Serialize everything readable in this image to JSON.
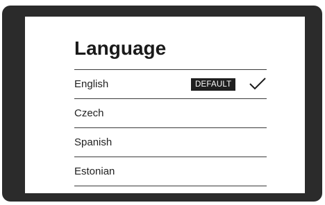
{
  "screen": {
    "title": "Language"
  },
  "languages": [
    {
      "label": "English",
      "badge": "DEFAULT",
      "selected": true
    },
    {
      "label": "Czech",
      "selected": false
    },
    {
      "label": "Spanish",
      "selected": false
    },
    {
      "label": "Estonian",
      "selected": false
    }
  ],
  "icons": {
    "selected": "checkmark-icon"
  },
  "colors": {
    "bezel": "#2b2b2b",
    "screen": "#ffffff",
    "text": "#222222",
    "badge_bg": "#1f1f1f",
    "badge_text": "#ffffff"
  }
}
